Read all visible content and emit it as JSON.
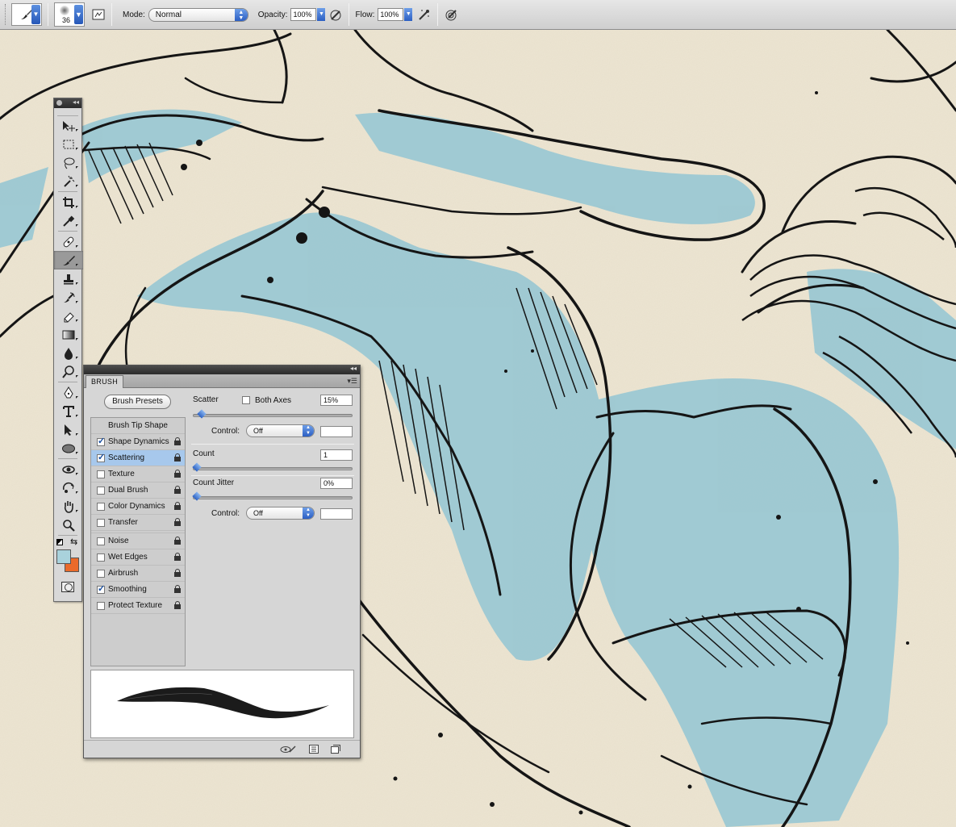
{
  "options_bar": {
    "brush_size": "36",
    "mode_label": "Mode:",
    "mode_value": "Normal",
    "opacity_label": "Opacity:",
    "opacity_value": "100%",
    "flow_label": "Flow:",
    "flow_value": "100%"
  },
  "tools": [
    {
      "name": "move-tool",
      "icon": "move-icon"
    },
    {
      "name": "marquee-tool",
      "icon": "rect-marquee-icon"
    },
    {
      "name": "lasso-tool",
      "icon": "lasso-icon"
    },
    {
      "name": "magic-wand-tool",
      "icon": "magic-wand-icon"
    },
    {
      "name": "crop-tool",
      "icon": "crop-icon"
    },
    {
      "name": "eyedropper-tool",
      "icon": "eyedropper-icon"
    },
    {
      "name": "healing-brush-tool",
      "icon": "bandage-icon"
    },
    {
      "name": "brush-tool",
      "icon": "brush-icon",
      "active": true
    },
    {
      "name": "clone-stamp-tool",
      "icon": "stamp-icon"
    },
    {
      "name": "history-brush-tool",
      "icon": "history-brush-icon"
    },
    {
      "name": "eraser-tool",
      "icon": "eraser-icon"
    },
    {
      "name": "gradient-tool",
      "icon": "gradient-icon"
    },
    {
      "name": "blur-tool",
      "icon": "drop-icon"
    },
    {
      "name": "dodge-tool",
      "icon": "dodge-icon"
    },
    {
      "name": "pen-tool",
      "icon": "pen-icon"
    },
    {
      "name": "type-tool",
      "icon": "type-icon"
    },
    {
      "name": "path-select-tool",
      "icon": "arrow-icon"
    },
    {
      "name": "shape-tool",
      "icon": "ellipse-icon"
    },
    {
      "name": "3d-rotate-tool",
      "icon": "3d-rotate-icon"
    },
    {
      "name": "3d-orbit-tool",
      "icon": "3d-orbit-icon"
    },
    {
      "name": "hand-tool",
      "icon": "hand-icon"
    },
    {
      "name": "zoom-tool",
      "icon": "zoom-icon"
    }
  ],
  "colors": {
    "foreground": "#a9d2dc",
    "background": "#ea6a2a",
    "ink": "#151515",
    "paper": "#ece4d0",
    "wash": "#9cc8d3"
  },
  "brush_panel": {
    "tab": "BRUSH",
    "presets_button": "Brush Presets",
    "options_header": "Brush Tip Shape",
    "options": [
      {
        "label": "Shape Dynamics",
        "checked": true
      },
      {
        "label": "Scattering",
        "checked": true,
        "selected": true
      },
      {
        "label": "Texture",
        "checked": false
      },
      {
        "label": "Dual Brush",
        "checked": false
      },
      {
        "label": "Color Dynamics",
        "checked": false
      },
      {
        "label": "Transfer",
        "checked": false
      },
      {
        "label": "Noise",
        "checked": false
      },
      {
        "label": "Wet Edges",
        "checked": false
      },
      {
        "label": "Airbrush",
        "checked": false
      },
      {
        "label": "Smoothing",
        "checked": true
      },
      {
        "label": "Protect Texture",
        "checked": false
      }
    ],
    "scatter_label": "Scatter",
    "both_axes_label": "Both Axes",
    "scatter_value": "15%",
    "scatter_level": 0.03,
    "control_label": "Control:",
    "control_value": "Off",
    "count_label": "Count",
    "count_value": "1",
    "count_level": 0.0,
    "count_jitter_label": "Count Jitter",
    "count_jitter_value": "0%",
    "count_jitter_level": 0.0,
    "control2_label": "Control:",
    "control2_value": "Off"
  }
}
